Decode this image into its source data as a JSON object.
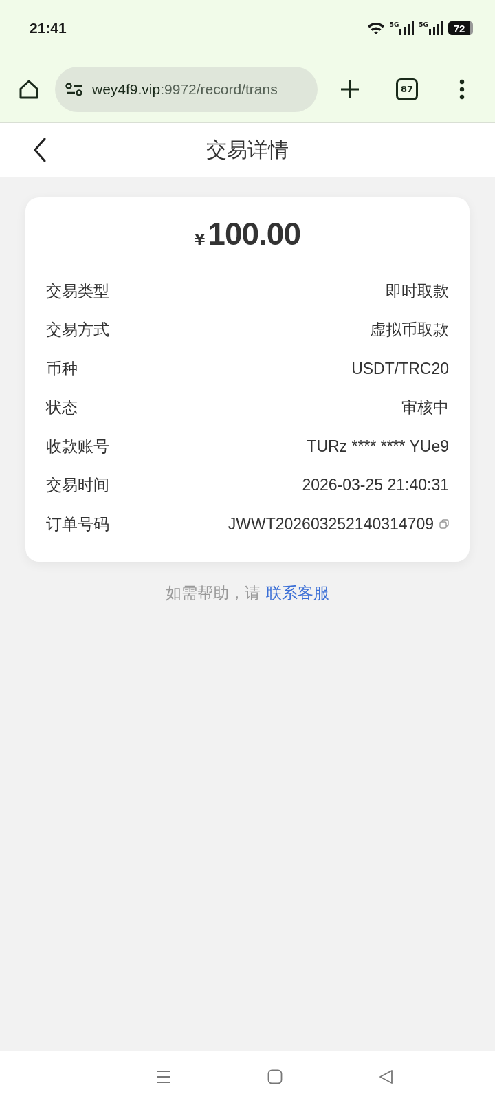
{
  "status_bar": {
    "time": "21:41",
    "networks": [
      "5G",
      "5G"
    ],
    "battery": "72"
  },
  "browser": {
    "url_host": "wey4f9.vip",
    "url_rest": ":9972/record/trans",
    "tab_count": "87"
  },
  "header": {
    "title": "交易详情"
  },
  "amount": {
    "currency": "¥",
    "value": "100.00"
  },
  "details": [
    {
      "label": "交易类型",
      "value": "即时取款"
    },
    {
      "label": "交易方式",
      "value": "虚拟币取款"
    },
    {
      "label": "币种",
      "value": "USDT/TRC20"
    },
    {
      "label": "状态",
      "value": "审核中"
    },
    {
      "label": "收款账号",
      "value": "TURz **** **** YUe9"
    },
    {
      "label": "交易时间",
      "value": "2026-03-25 21:40:31"
    },
    {
      "label": "订单号码",
      "value": "JWWT202603252140314709",
      "copyable": true
    }
  ],
  "help": {
    "text": "如需帮助，请",
    "link": "联系客服"
  }
}
